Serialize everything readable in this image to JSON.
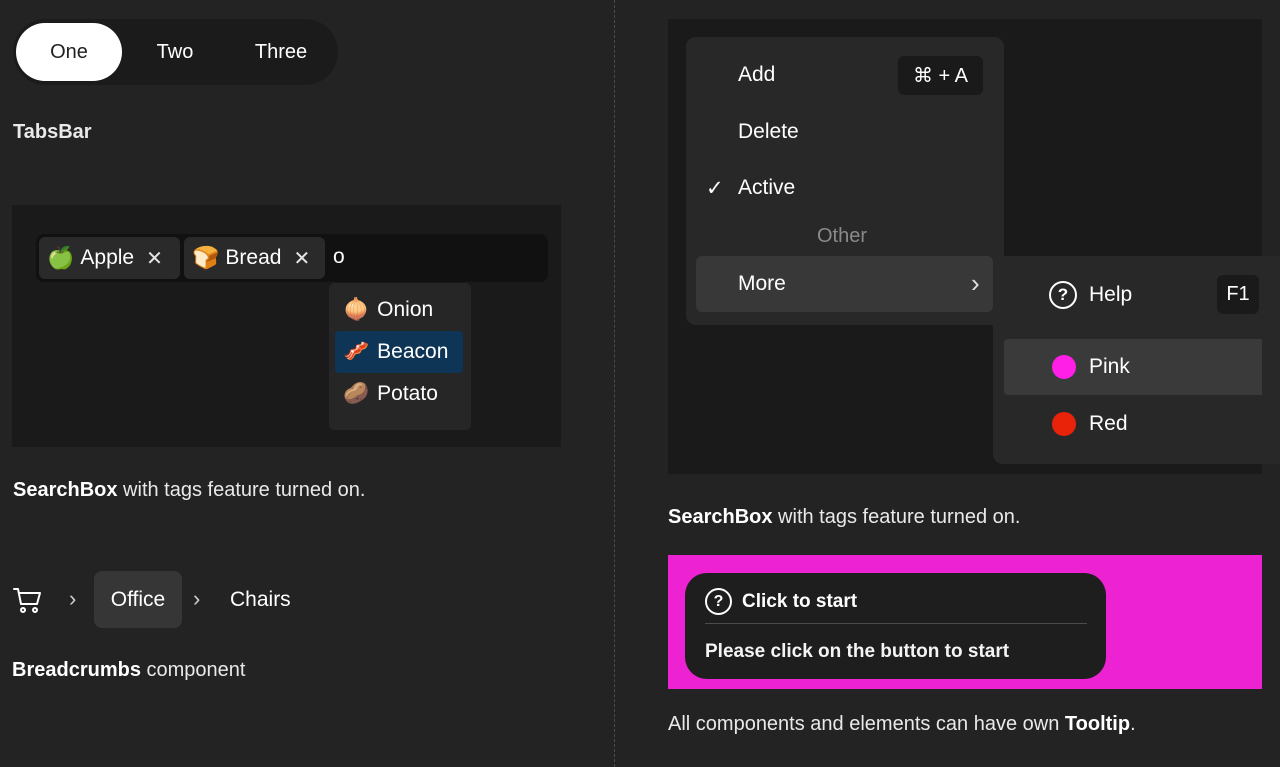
{
  "tabs": {
    "items": [
      {
        "label": "One",
        "active": true
      },
      {
        "label": "Two",
        "active": false
      },
      {
        "label": "Three",
        "active": false
      }
    ],
    "caption": "TabsBar"
  },
  "searchbox": {
    "tags": [
      {
        "emoji": "🍏",
        "label": "Apple",
        "remove": "✕"
      },
      {
        "emoji": "🍞",
        "label": "Bread",
        "remove": "✕"
      }
    ],
    "query": "o",
    "options": [
      {
        "emoji": "🧅",
        "label": "Onion"
      },
      {
        "emoji": "🥓",
        "label": "Beacon",
        "selected": true
      },
      {
        "emoji": "🥔",
        "label": "Potato"
      }
    ],
    "caption_bold": "SearchBox",
    "caption_rest": " with tags feature turned on."
  },
  "breadcrumbs": {
    "items": [
      "Office",
      "Chairs"
    ],
    "separator": "›",
    "caption_bold": "Breadcrumbs",
    "caption_rest": " component"
  },
  "menu": {
    "items": [
      {
        "label": "Add",
        "shortcut": "⌘ + A"
      },
      {
        "label": "Delete"
      },
      {
        "label": "Active",
        "checked": true,
        "check": "✓"
      }
    ],
    "group_label": "Other",
    "more_label": "More",
    "more_chevron": "›",
    "submenu": {
      "help_label": "Help",
      "help_shortcut": "F1",
      "help_icon": "?",
      "colors": [
        {
          "label": "Pink",
          "color": "#ff1fe6"
        },
        {
          "label": "Red",
          "color": "#e8230a"
        }
      ]
    },
    "caption_bold": "SearchBox",
    "caption_rest": " with tags feature turned on."
  },
  "tooltip": {
    "icon": "?",
    "title": "Click to start",
    "body": "Please click on the button to start",
    "caption_prefix": "All components and elements can have own ",
    "caption_bold": "Tooltip",
    "caption_suffix": ".",
    "bg_color": "#ec22d3"
  }
}
